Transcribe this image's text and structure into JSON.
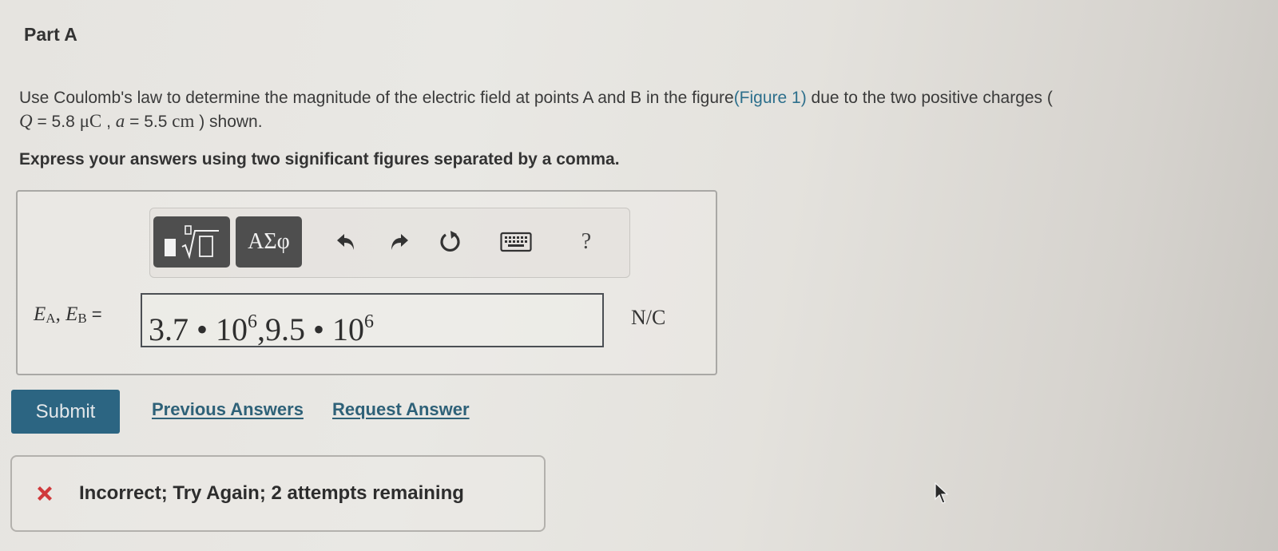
{
  "part": {
    "title": "Part A"
  },
  "question": {
    "text_before_link": "Use Coulomb's law to determine the magnitude of the electric field at points A and B in the figure",
    "link_text": "(Figure 1)",
    "text_after_link": " due to the two positive charges (",
    "q_symbol": "Q",
    "q_value": " = 5.8 ",
    "q_unit": "μC",
    "separator": " , ",
    "a_symbol": "a",
    "a_value": " = 5.5 ",
    "a_unit": "cm",
    "text_end": " ) shown."
  },
  "instruction": "Express your answers using two significant figures separated by a comma.",
  "toolbar": {
    "templates_icon": "templates-sqrt-icon",
    "greek_label": "ΑΣφ",
    "undo_icon": "undo-icon",
    "redo_icon": "redo-icon",
    "reset_icon": "reset-icon",
    "keyboard_icon": "keyboard-icon",
    "help_label": "?"
  },
  "answer": {
    "label_var1": "E",
    "label_sub1": "A",
    "label_var2": "E",
    "label_sub2": "B",
    "label_sep": ", ",
    "equals": "=",
    "value_part1": "3.7 • 10",
    "exp1": "6",
    "value_sep": ",",
    "value_part2": "9.5 • 10",
    "exp2": "6",
    "unit": "N/C"
  },
  "actions": {
    "submit_label": "Submit",
    "previous_answers_label": "Previous Answers",
    "request_answer_label": "Request Answer"
  },
  "feedback": {
    "status": "incorrect",
    "message": "Incorrect; Try Again; 2 attempts remaining",
    "icon_color": "#d0393b"
  },
  "colors": {
    "submit_bg": "#2c6582",
    "link": "#2e6178",
    "error": "#d0393b"
  }
}
